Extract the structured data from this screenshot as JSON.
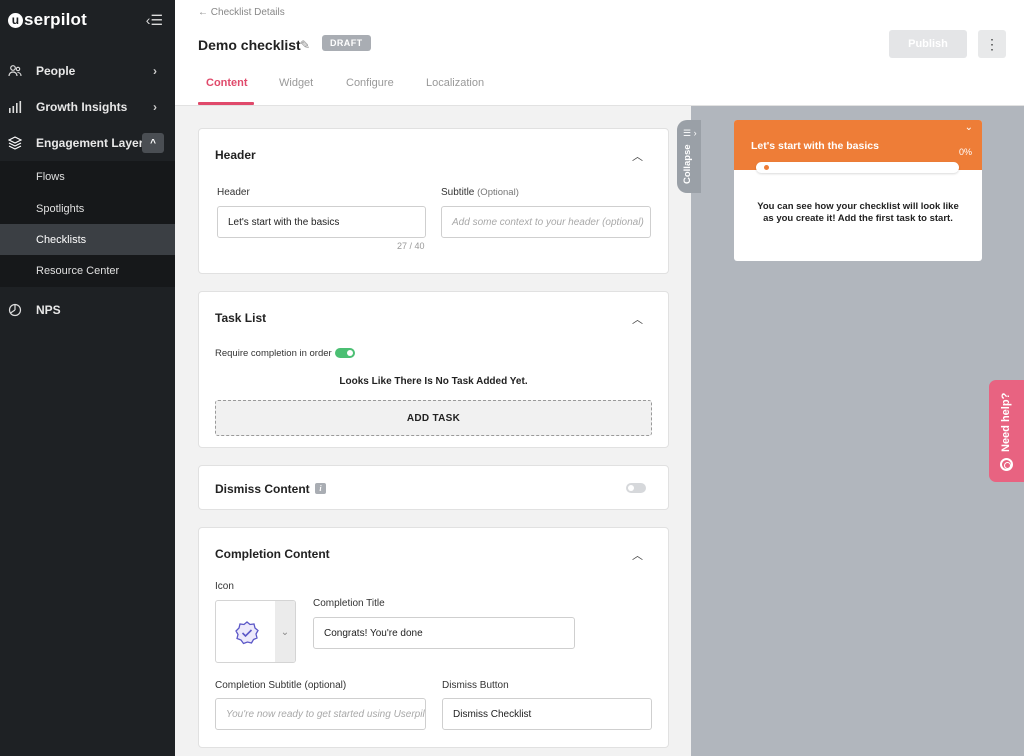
{
  "sidebar": {
    "logo_text": "serpilot",
    "logo_initial": "u",
    "items": [
      {
        "label": "People",
        "icon": "people-icon"
      },
      {
        "label": "Growth Insights",
        "icon": "bar-chart-icon"
      },
      {
        "label": "Engagement Layer",
        "icon": "layers-icon"
      },
      {
        "label": "NPS",
        "icon": "gauge-icon"
      }
    ],
    "sub_items": [
      {
        "label": "Flows"
      },
      {
        "label": "Spotlights"
      },
      {
        "label": "Checklists"
      },
      {
        "label": "Resource Center"
      }
    ]
  },
  "header": {
    "breadcrumb": "Checklist Details",
    "title": "Demo checklist",
    "status_badge": "DRAFT",
    "publish_label": "Publish",
    "more_label": "⋮"
  },
  "tabs": [
    {
      "label": "Content"
    },
    {
      "label": "Widget"
    },
    {
      "label": "Configure"
    },
    {
      "label": "Localization"
    }
  ],
  "header_section": {
    "title": "Header",
    "header_label": "Header",
    "header_value": "Let's start with the basics",
    "header_counter": "27 / 40",
    "subtitle_label": "Subtitle",
    "subtitle_optional": "(Optional)",
    "subtitle_placeholder": "Add some context to your header (optional)"
  },
  "task_list": {
    "title": "Task List",
    "require_label": "Require completion in order",
    "require_enabled": true,
    "empty_message": "Looks Like There Is No Task Added Yet.",
    "add_task_label": "ADD TASK"
  },
  "dismiss_content": {
    "title": "Dismiss Content",
    "info_glyph": "i",
    "enabled": false
  },
  "completion": {
    "title": "Completion Content",
    "icon_label": "Icon",
    "title_label": "Completion Title",
    "title_value": "Congrats! You're done",
    "subtitle_label": "Completion Subtitle (optional)",
    "subtitle_placeholder": "You're now ready to get started using Userpilot",
    "dismiss_label": "Dismiss Button",
    "dismiss_value": "Dismiss Checklist"
  },
  "preview": {
    "collapse_label": "Collapse",
    "widget_title": "Let's start with the basics",
    "widget_percent": "0%",
    "widget_progress": 0,
    "widget_body": "You can see how your checklist will look like as you create it! Add the first task to start."
  },
  "help": {
    "label": "Need help?"
  },
  "colors": {
    "accent": "#e04a6b",
    "widget": "#ee7d37",
    "toggle_on": "#4bbf73",
    "sidebar": "#1e2124"
  }
}
